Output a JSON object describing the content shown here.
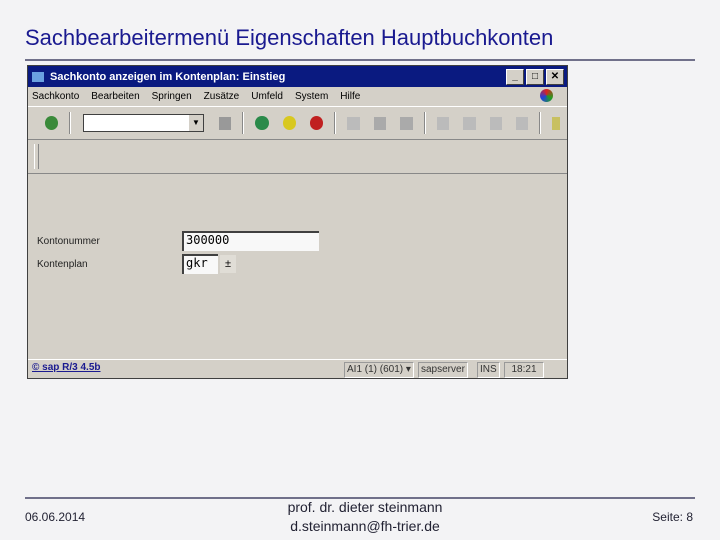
{
  "slide": {
    "title": "Sachbearbeitermenü Eigenschaften Hauptbuchkonten",
    "date": "06.06.2014",
    "author": "prof. dr. dieter steinmann",
    "email": "d.steinmann@fh-trier.de",
    "page": "Seite: 8"
  },
  "window": {
    "title": "Sachkonto anzeigen im Kontenplan: Einstieg",
    "menu": [
      "Sachkonto",
      "Bearbeiten",
      "Springen",
      "Zusätze",
      "Umfeld",
      "System",
      "Hilfe"
    ],
    "fields": {
      "konto_label": "Kontonummer",
      "konto_value": "300000",
      "plan_label": "Kontenplan",
      "plan_value": "gkr"
    },
    "status": {
      "link": "© sap R/3 4.5b",
      "session": "AI1 (1) (601)",
      "server": "sapserver",
      "mode": "INS",
      "time": "18:21"
    }
  }
}
